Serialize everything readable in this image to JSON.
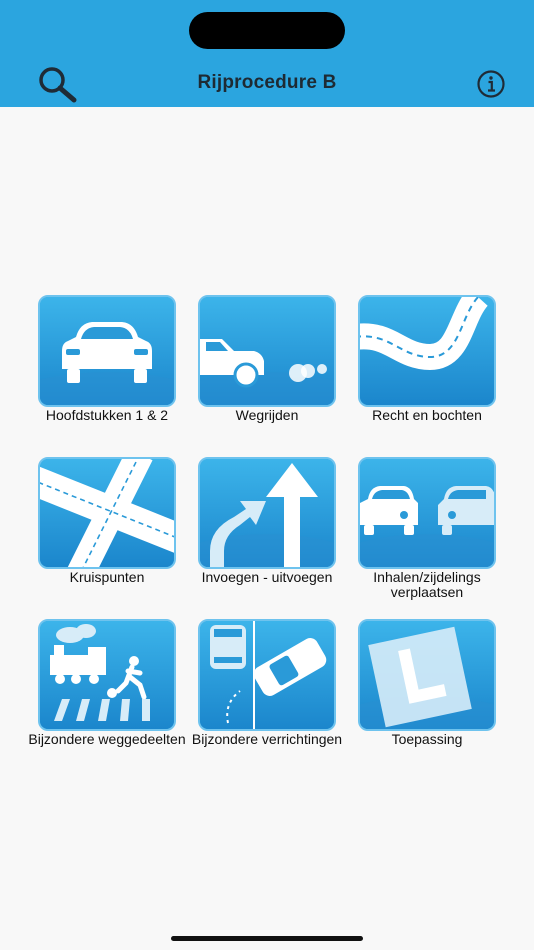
{
  "header": {
    "title": "Rijprocedure B",
    "search_icon": "search-icon",
    "info_icon": "info-icon",
    "color": "#2ba5df"
  },
  "tiles": [
    {
      "label": "Hoofdstukken 1 & 2",
      "icon": "car-front-icon"
    },
    {
      "label": "Wegrijden",
      "icon": "car-driving-away-icon"
    },
    {
      "label": "Recht en bochten",
      "icon": "winding-road-icon"
    },
    {
      "label": "Kruispunten",
      "icon": "crossroads-icon"
    },
    {
      "label": "Invoegen - uitvoegen",
      "icon": "merge-arrows-icon"
    },
    {
      "label": "Inhalen/zijdelings verplaatsen",
      "icon": "overtaking-cars-icon"
    },
    {
      "label": "Bijzondere weggedeelten",
      "icon": "train-crossing-icon"
    },
    {
      "label": "Bijzondere verrichtingen",
      "icon": "parking-maneuver-icon"
    },
    {
      "label": "Toepassing",
      "icon": "learner-plate-icon"
    }
  ]
}
